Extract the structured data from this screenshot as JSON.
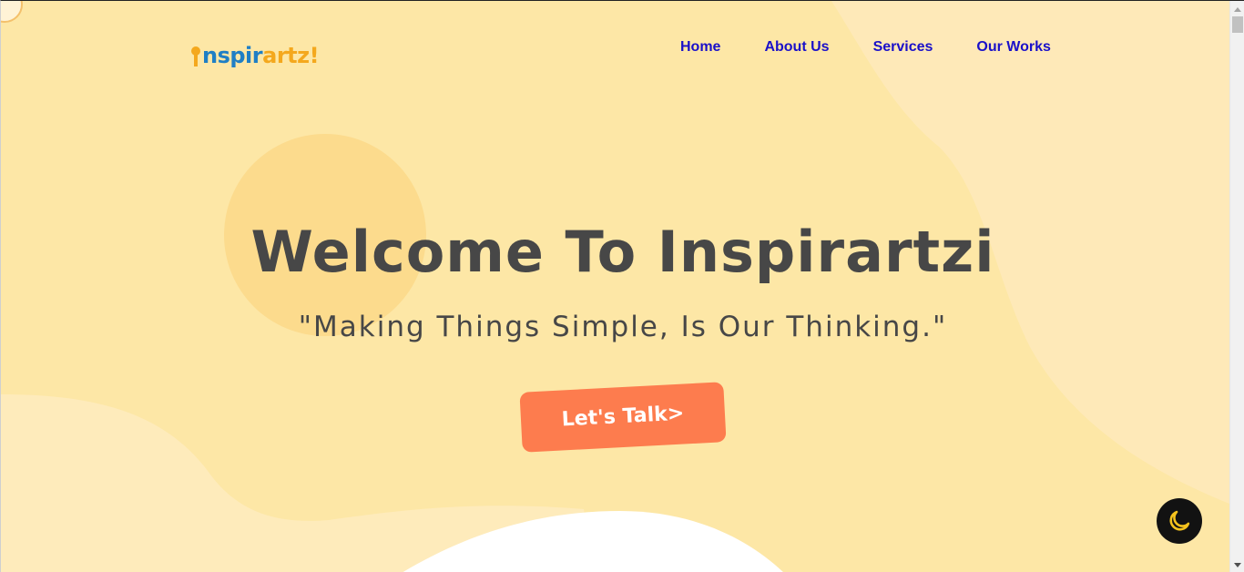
{
  "header": {
    "logo": {
      "part1": "nspir",
      "part2": "artz!"
    },
    "nav": [
      {
        "label": "Home"
      },
      {
        "label": "About Us"
      },
      {
        "label": "Services"
      },
      {
        "label": "Our Works"
      }
    ]
  },
  "hero": {
    "title": "Welcome To Inspirartzi",
    "subtitle": "\"Making Things Simple, Is Our Thinking.\"",
    "cta_label": "Let's Talk>"
  },
  "theme_toggle": {
    "icon": "moon-icon"
  },
  "colors": {
    "background": "#fde7a6",
    "background_light": "#feebbb",
    "deco_circle": "#fcdb8d",
    "nav_link": "#1a10c9",
    "heading": "#474747",
    "cta": "#fd7c4e",
    "logo_blue": "#1f7fc5",
    "logo_orange": "#f4a81d",
    "toggle_bg": "#121212",
    "moon": "#f4c21d"
  }
}
